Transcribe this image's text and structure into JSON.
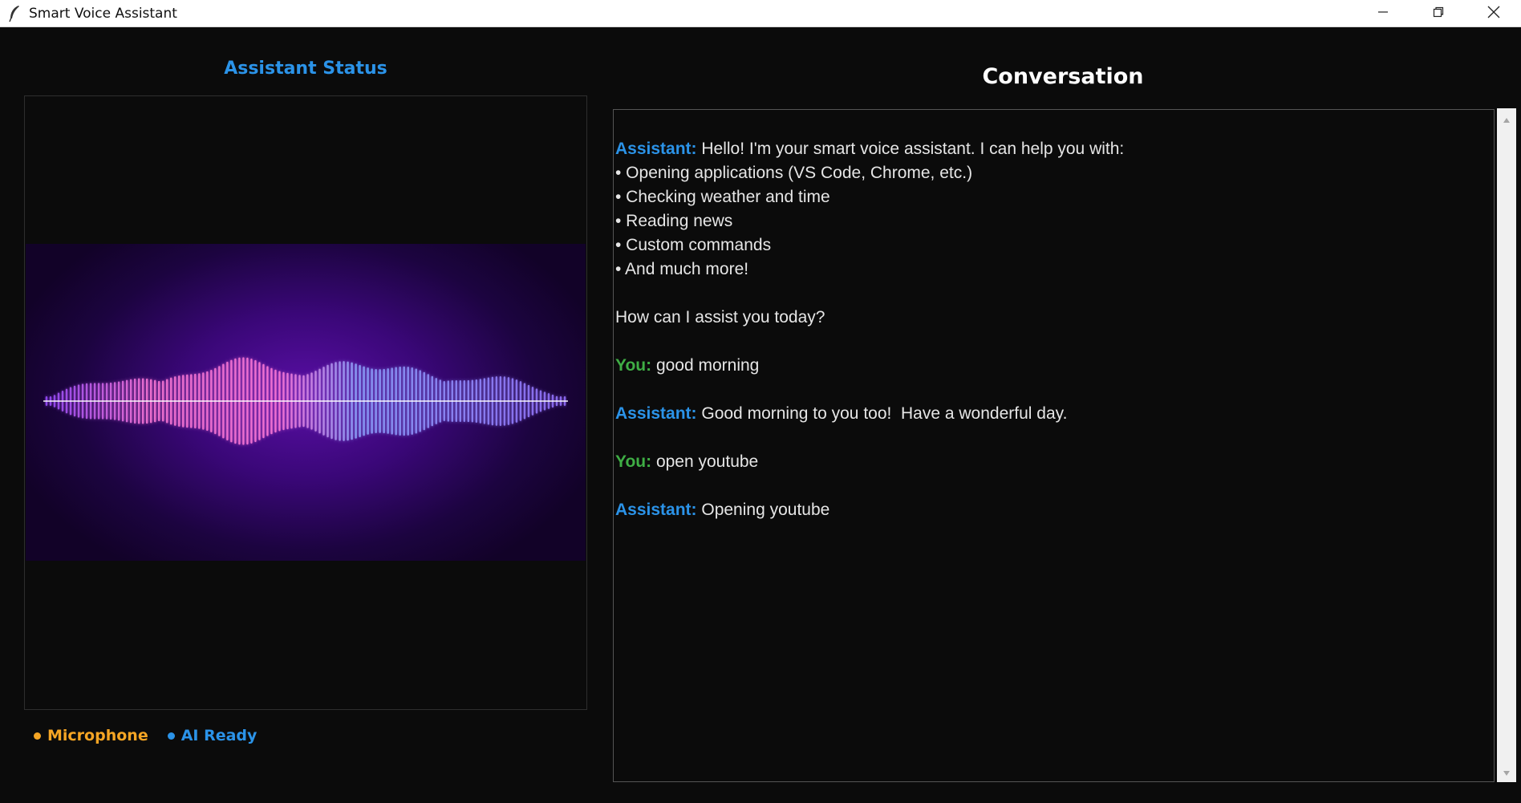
{
  "window": {
    "title": "Smart Voice Assistant",
    "icon": "feather-icon",
    "controls": [
      "minimize-icon",
      "restore-icon",
      "close-icon"
    ]
  },
  "left_panel": {
    "title": "Assistant Status",
    "visualizer": {
      "icon": "sound-wave-image",
      "colors": {
        "background": "#3a0778",
        "wave_pink": "#ff7ad9",
        "wave_blue": "#8fa8ff",
        "wave_violet": "#9a4dff"
      }
    },
    "indicators": [
      {
        "label": "Microphone",
        "color": "#f5a524"
      },
      {
        "label": "AI Ready",
        "color": "#2b93e8"
      }
    ]
  },
  "conversation": {
    "title": "Conversation",
    "colors": {
      "assistant": "#2b93e8",
      "user": "#3fae45",
      "text": "#e6e6e6"
    },
    "lines": [
      {
        "speaker": "Assistant:",
        "role": "assistant",
        "text": " Hello! I'm your smart voice assistant. I can help you with:"
      },
      {
        "speaker": "",
        "role": "",
        "text": "• Opening applications (VS Code, Chrome, etc.)"
      },
      {
        "speaker": "",
        "role": "",
        "text": "• Checking weather and time"
      },
      {
        "speaker": "",
        "role": "",
        "text": "• Reading news"
      },
      {
        "speaker": "",
        "role": "",
        "text": "• Custom commands"
      },
      {
        "speaker": "",
        "role": "",
        "text": "• And much more!"
      },
      {
        "speaker": "",
        "role": "",
        "text": ""
      },
      {
        "speaker": "",
        "role": "",
        "text": "How can I assist you today?"
      },
      {
        "speaker": "",
        "role": "",
        "text": ""
      },
      {
        "speaker": "You:",
        "role": "user",
        "text": " good morning"
      },
      {
        "speaker": "",
        "role": "",
        "text": ""
      },
      {
        "speaker": "Assistant:",
        "role": "assistant",
        "text": " Good morning to you too!  Have a wonderful day."
      },
      {
        "speaker": "",
        "role": "",
        "text": ""
      },
      {
        "speaker": "You:",
        "role": "user",
        "text": " open youtube"
      },
      {
        "speaker": "",
        "role": "",
        "text": ""
      },
      {
        "speaker": "Assistant:",
        "role": "assistant",
        "text": " Opening youtube"
      }
    ]
  }
}
